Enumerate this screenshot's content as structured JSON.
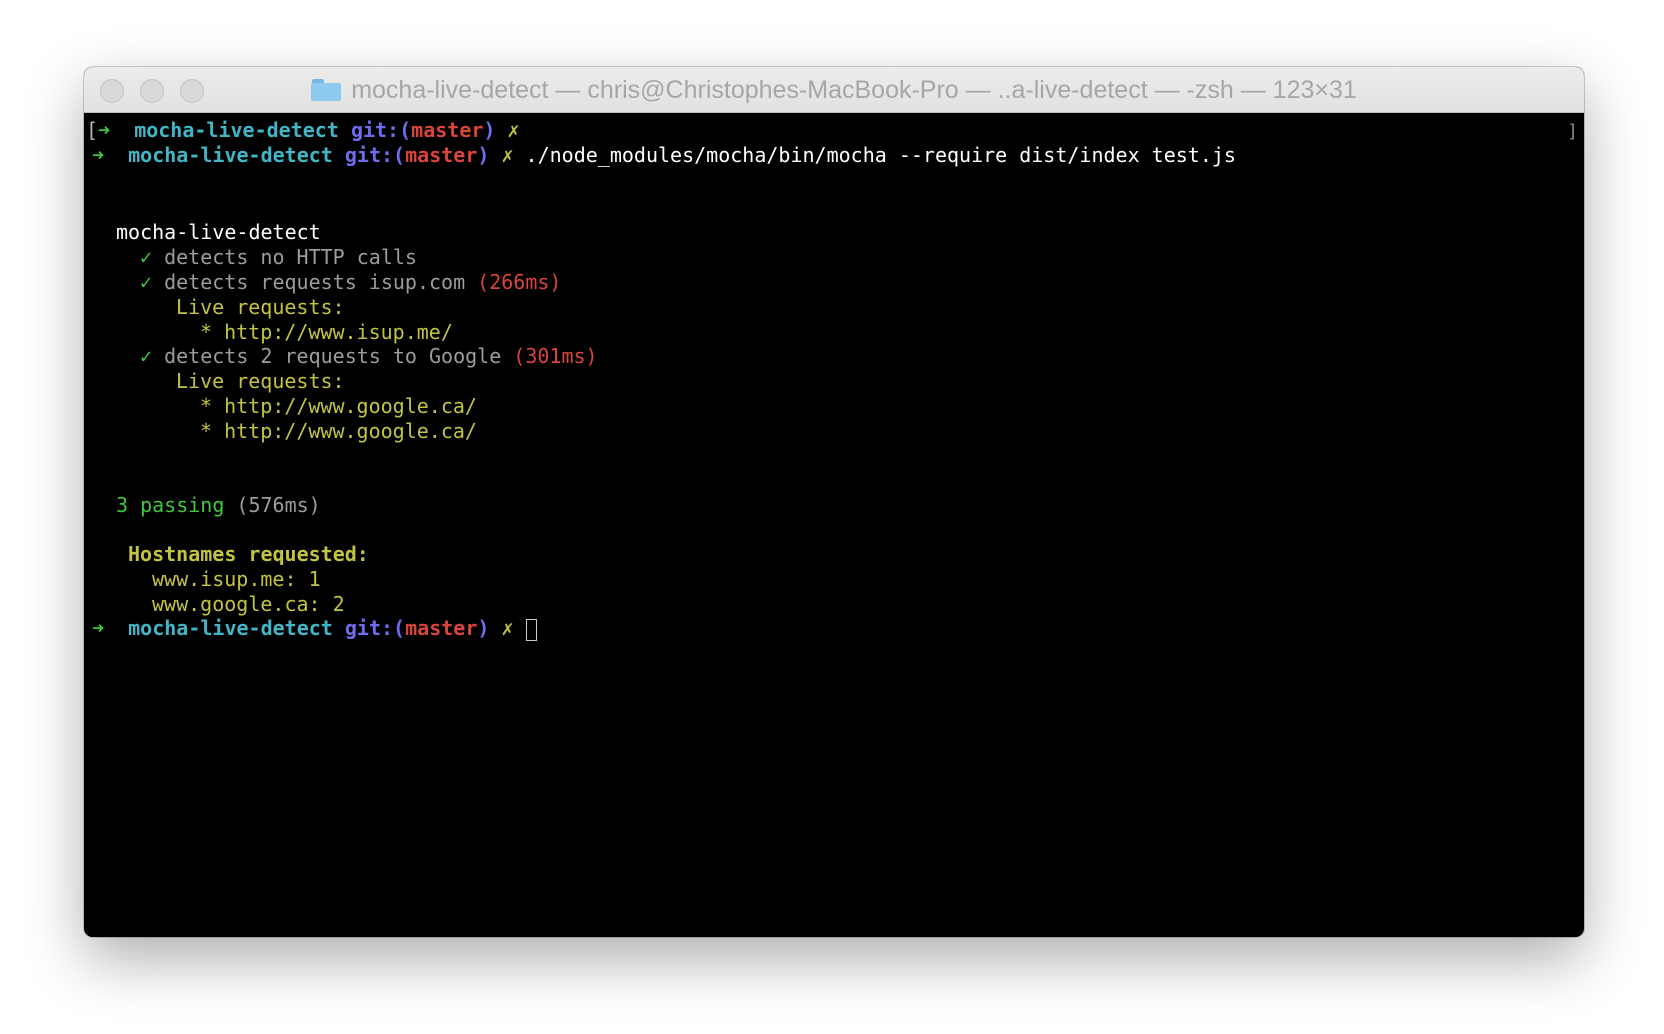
{
  "window": {
    "title": "mocha-live-detect — chris@Christophes-MacBook-Pro — ..a-live-detect — -zsh — 123×31"
  },
  "prompt": {
    "arrow": "➜",
    "dir": "mocha-live-detect",
    "git_prefix": "git:(",
    "branch": "master",
    "git_suffix": ")",
    "dirty": "✗",
    "open_bracket": "[",
    "scroll_marker": "]"
  },
  "command": "./node_modules/mocha/bin/mocha --require dist/index test.js",
  "output": {
    "suite_name": "mocha-live-detect",
    "check": "✓",
    "tests": [
      {
        "title": "detects no HTTP calls",
        "duration": ""
      },
      {
        "title": "detects requests isup.com",
        "duration": "(266ms)"
      },
      {
        "title": "detects 2 requests to Google",
        "duration": "(301ms)"
      }
    ],
    "live_requests_label": "Live requests:",
    "bullet": "*",
    "urls": [
      "http://www.isup.me/",
      "http://www.google.ca/",
      "http://www.google.ca/"
    ],
    "passing": "3 passing",
    "passing_time": "(576ms)",
    "hostnames_label": "Hostnames requested:",
    "hostnames": [
      "www.isup.me: 1",
      "www.google.ca: 2"
    ]
  },
  "colors": {
    "green": "#3ec83e",
    "cyan": "#42b6c7",
    "blue": "#6f6cf0",
    "red": "#d9443b",
    "yellow": "#c3c343",
    "gray": "#9c9c9c"
  }
}
